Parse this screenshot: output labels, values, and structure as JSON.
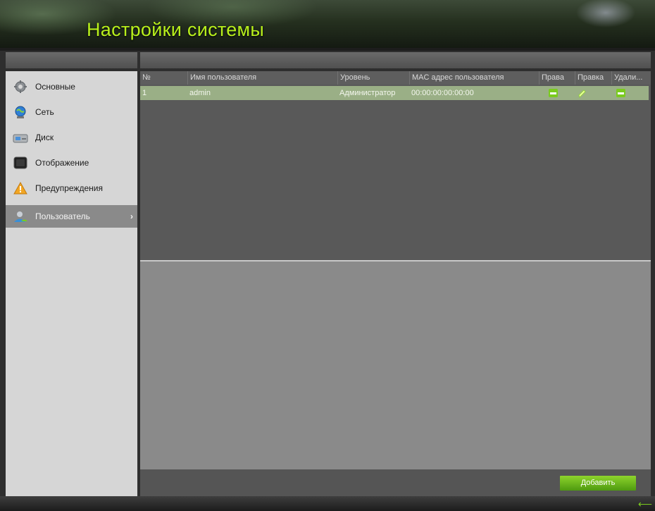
{
  "header": {
    "title": "Настройки системы"
  },
  "sidebar": {
    "items": [
      {
        "label": "Основные",
        "icon": "gear-icon"
      },
      {
        "label": "Сеть",
        "icon": "network-globe-icon"
      },
      {
        "label": "Диск",
        "icon": "hard-disk-icon"
      },
      {
        "label": "Отображение",
        "icon": "monitor-icon"
      },
      {
        "label": "Предупреждения",
        "icon": "warning-icon"
      },
      {
        "label": "Пользователь",
        "icon": "user-icon",
        "active": true,
        "arrow": "›"
      }
    ]
  },
  "table": {
    "columns": [
      "№",
      "Имя пользователя",
      "Уровень",
      "MAC адрес пользователя",
      "Права",
      "Правка",
      "Удали..."
    ],
    "rows": [
      {
        "num": "1",
        "name": "admin",
        "level": "Администратор",
        "mac": "00:00:00:00:00:00"
      }
    ]
  },
  "footer": {
    "add_label": "Добавить"
  },
  "colors": {
    "accent": "#7acb1e",
    "title": "#b8f01c",
    "row_selected": "#9aaf86"
  }
}
